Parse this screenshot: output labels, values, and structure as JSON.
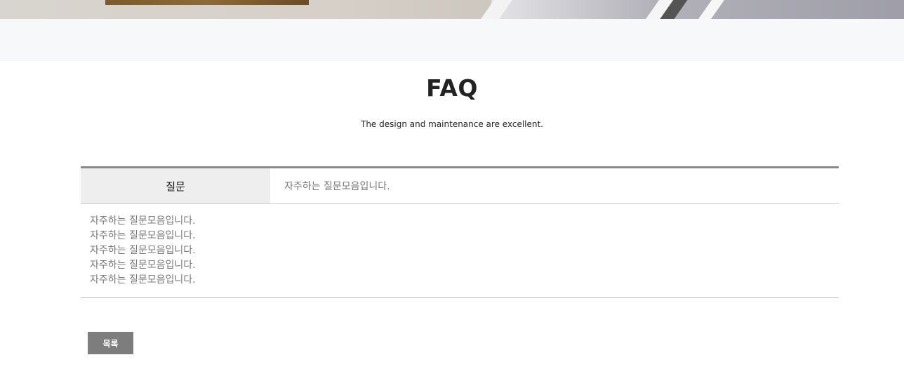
{
  "page": {
    "title": "FAQ",
    "subtitle": "The design and maintenance are excellent."
  },
  "faq": {
    "label": "질문",
    "subject": "자주하는 질문모음입니다.",
    "body_lines": [
      "자주하는 질문모음입니다.",
      "자주하는 질문모음입니다.",
      "자주하는 질문모음입니다.",
      "자주하는 질문모음입니다.",
      "자주하는 질문모음입니다."
    ]
  },
  "actions": {
    "list_label": "목록"
  },
  "colors": {
    "table_top_border": "#8a8a8a",
    "label_bg": "#eeeeee",
    "button_bg": "#7d7d7d",
    "band_bg": "#f7f8fa"
  }
}
